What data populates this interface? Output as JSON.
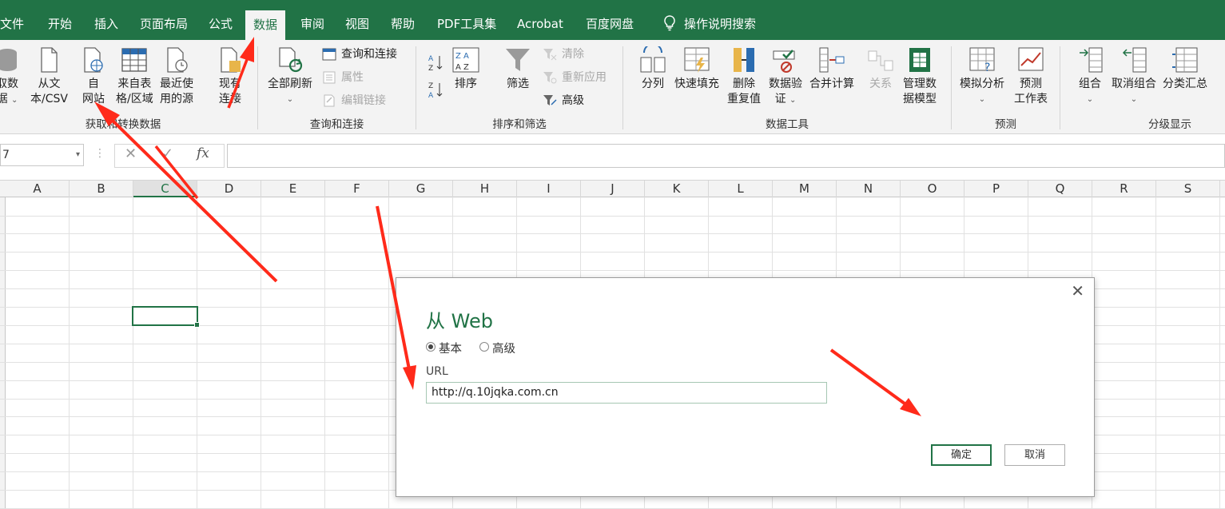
{
  "menu": {
    "tabs": [
      "文件",
      "开始",
      "插入",
      "页面布局",
      "公式",
      "数据",
      "审阅",
      "视图",
      "帮助",
      "PDF工具集",
      "Acrobat",
      "百度网盘"
    ],
    "active_tab": "数据",
    "search_label": "操作说明搜索"
  },
  "ribbon": {
    "get_data": {
      "label": "获取和转换数据",
      "get_data_btn": [
        "取数",
        "据"
      ],
      "from_text_csv": [
        "从文",
        "本/CSV"
      ],
      "from_web": [
        "自",
        "网站"
      ],
      "from_table": [
        "来自表",
        "格/区域"
      ],
      "recent_sources": [
        "最近使",
        "用的源"
      ],
      "existing_connections": [
        "现有",
        "连接"
      ]
    },
    "queries": {
      "label": "查询和连接",
      "refresh_all": "全部刷新",
      "queries_connections": "查询和连接",
      "properties": "属性",
      "edit_links": "编辑链接"
    },
    "sort_filter": {
      "label": "排序和筛选",
      "sort": "排序",
      "filter": "筛选",
      "clear": "清除",
      "reapply": "重新应用",
      "advanced": "高级"
    },
    "data_tools": {
      "label": "数据工具",
      "text_to_columns": "分列",
      "flash_fill": "快速填充",
      "remove_duplicates": [
        "删除",
        "重复值"
      ],
      "data_validation": [
        "数据验",
        "证"
      ],
      "consolidate": "合并计算",
      "relationships": "关系",
      "manage_data_model": [
        "管理数",
        "据模型"
      ]
    },
    "forecast": {
      "label": "预测",
      "what_if": "模拟分析",
      "forecast_sheet": [
        "预测",
        "工作表"
      ]
    },
    "outline": {
      "label": "分级显示",
      "group": "组合",
      "ungroup": "取消组合",
      "subtotal": "分类汇总"
    }
  },
  "formula_bar": {
    "name_box": "7",
    "fx": "fx"
  },
  "grid": {
    "columns": [
      "A",
      "B",
      "C",
      "D",
      "E",
      "F",
      "G",
      "H",
      "I",
      "J",
      "K",
      "L",
      "M",
      "N",
      "O",
      "P",
      "Q",
      "R",
      "S"
    ],
    "selected_column": "C"
  },
  "dialog": {
    "title": "从 Web",
    "radio_basic": "基本",
    "radio_advanced": "高级",
    "url_label": "URL",
    "url_value": "http://q.10jqka.com.cn",
    "ok": "确定",
    "cancel": "取消"
  },
  "colors": {
    "excel_green": "#217346",
    "arrow_red": "#ff2a1a"
  }
}
